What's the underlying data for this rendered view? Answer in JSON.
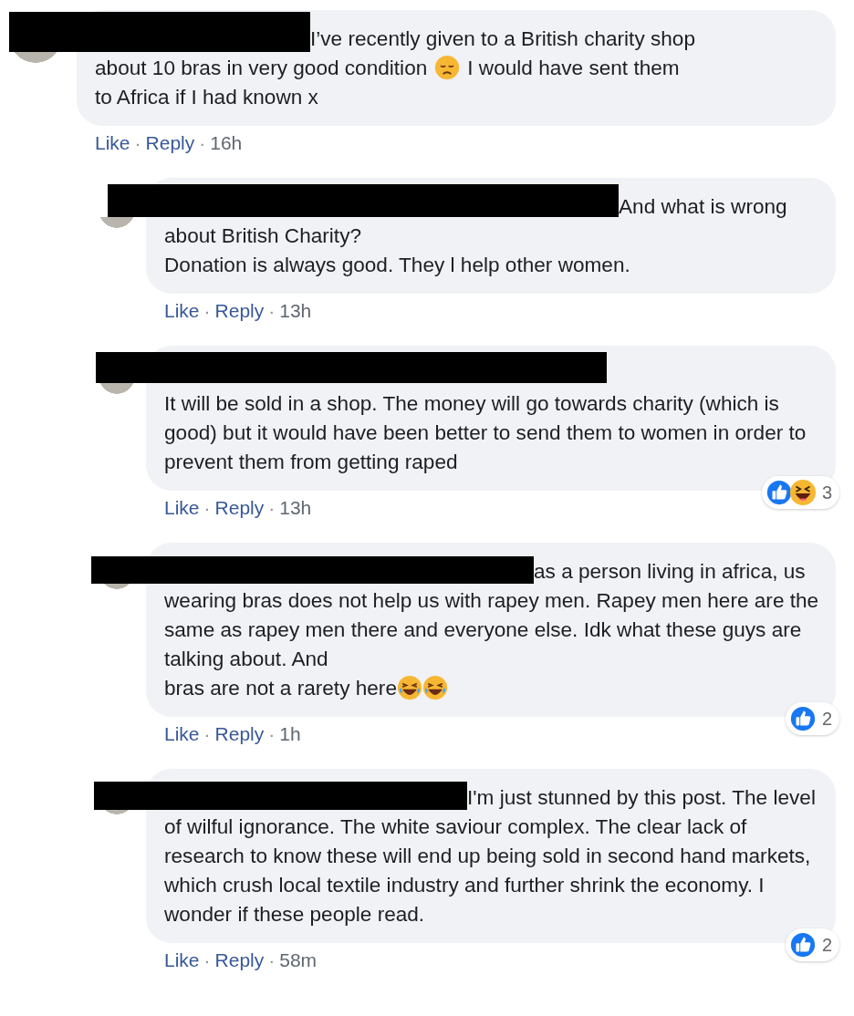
{
  "comment": {
    "name_redacted": true,
    "body": [
      {
        "kind": "text",
        "text": "I’ve recently given to a British charity shop"
      },
      {
        "kind": "break"
      },
      {
        "kind": "text",
        "text": "about 10 bras in very good condition"
      },
      {
        "kind": "sad-face"
      },
      {
        "kind": "text",
        "text": "I would have sent them"
      },
      {
        "kind": "break"
      },
      {
        "kind": "text",
        "text": "to Africa if I had known x"
      }
    ],
    "actions": [
      {
        "kind": "link",
        "text": "Like"
      },
      {
        "kind": "separator",
        "text": "·"
      },
      {
        "kind": "link",
        "text": "Reply"
      },
      {
        "kind": "separator",
        "text": "·"
      },
      {
        "kind": "time",
        "text": "16h"
      }
    ],
    "replies": [
      {
        "name_redacted": true,
        "body": [
          {
            "kind": "text",
            "text": "And what is wrong about British Charity?\nDonation is always good. They l help other women."
          }
        ],
        "actions": [
          {
            "kind": "link",
            "text": "Like"
          },
          {
            "kind": "separator",
            "text": "·"
          },
          {
            "kind": "link",
            "text": "Reply"
          },
          {
            "kind": "separator",
            "text": "·"
          },
          {
            "kind": "time",
            "text": "13h"
          }
        ]
      },
      {
        "name_redacted": true,
        "body": [
          {
            "kind": "text",
            "text": "It will be sold in a shop. The money will go towards charity (which is good) but it would have been better to send them to women in order to prevent them from getting raped"
          }
        ],
        "actions": [
          {
            "kind": "link",
            "text": "Like"
          },
          {
            "kind": "separator",
            "text": "·"
          },
          {
            "kind": "link",
            "text": "Reply"
          },
          {
            "kind": "separator",
            "text": "·"
          },
          {
            "kind": "time",
            "text": "13h"
          }
        ],
        "reactions": {
          "icons": [
            {
              "kind": "like"
            },
            {
              "kind": "haha"
            }
          ],
          "count": "3"
        }
      },
      {
        "name_redacted": true,
        "body": [
          {
            "kind": "text",
            "text": "as a person living in africa, us wearing bras does not help us with rapey men. Rapey men here are the same as rapey men there and everyone else. Idk what these guys are talking about. And"
          },
          {
            "kind": "break"
          },
          {
            "kind": "text",
            "text": "bras are not a rarety here"
          },
          {
            "kind": "laughing-face"
          },
          {
            "kind": "laughing-face"
          }
        ],
        "actions": [
          {
            "kind": "link",
            "text": "Like"
          },
          {
            "kind": "separator",
            "text": "·"
          },
          {
            "kind": "link",
            "text": "Reply"
          },
          {
            "kind": "separator",
            "text": "·"
          },
          {
            "kind": "time",
            "text": "1h"
          }
        ],
        "reactions": {
          "icons": [
            {
              "kind": "like"
            }
          ],
          "count": "2"
        }
      },
      {
        "name_redacted": true,
        "body": [
          {
            "kind": "text",
            "text": "I'm just stunned by this post. The level of wilful ignorance. The white saviour complex. The clear lack of research to know these will end up being sold in second hand markets, which crush local textile industry and further shrink the economy. I wonder if these people read."
          }
        ],
        "actions": [
          {
            "kind": "link",
            "text": "Like"
          },
          {
            "kind": "separator",
            "text": "·"
          },
          {
            "kind": "link",
            "text": "Reply"
          },
          {
            "kind": "separator",
            "text": "·"
          },
          {
            "kind": "time",
            "text": "58m"
          }
        ],
        "reactions": {
          "icons": [
            {
              "kind": "like"
            }
          ],
          "count": "2"
        }
      }
    ]
  }
}
